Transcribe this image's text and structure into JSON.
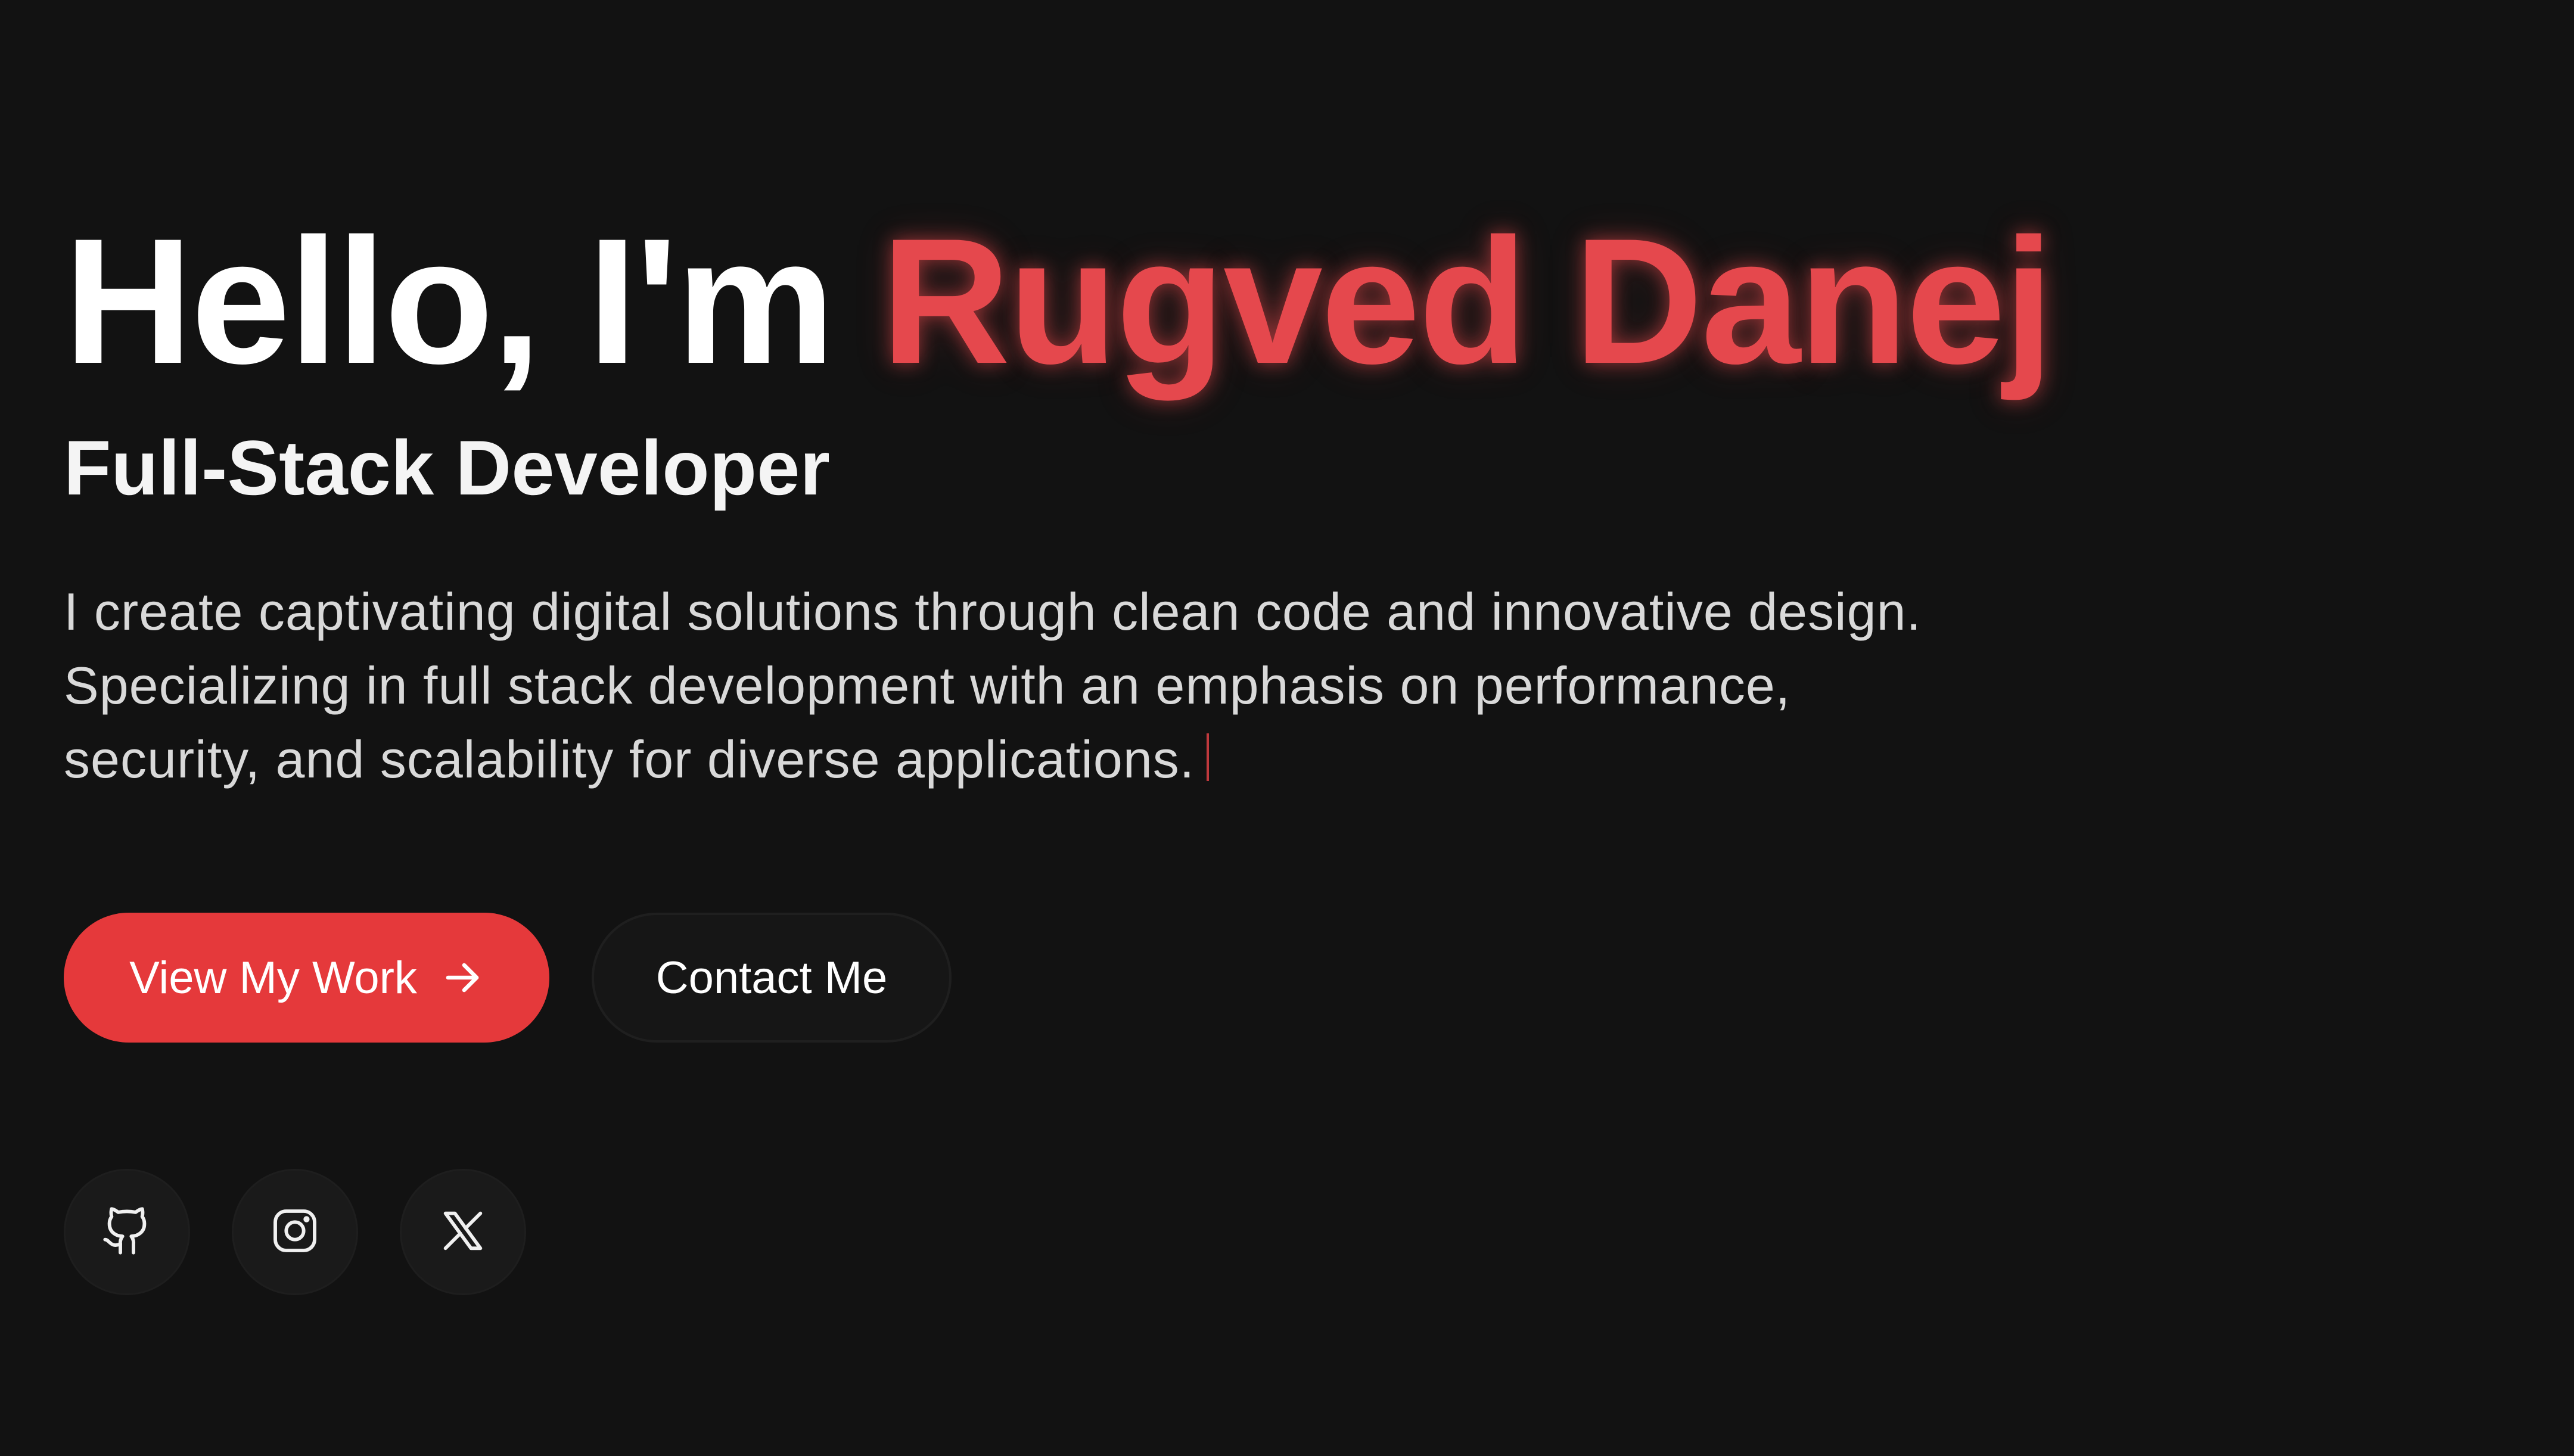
{
  "hero": {
    "greeting": "Hello, I'm",
    "name": "Rugved Danej",
    "role": "Full-Stack Developer",
    "bio_lines": [
      "I create captivating digital solutions through clean code and innovative design.",
      "Specializing in full stack development with an emphasis on performance,",
      "security, and scalability for diverse applications."
    ]
  },
  "buttons": {
    "primary_label": "View My Work",
    "primary_icon": "arrow-right-icon",
    "secondary_label": "Contact Me"
  },
  "social": [
    {
      "icon": "github-icon"
    },
    {
      "icon": "instagram-icon"
    },
    {
      "icon": "x-twitter-icon"
    }
  ],
  "colors": {
    "background": "#121212",
    "accent": "#e5393b",
    "name_highlight": "#e5484d",
    "text": "#ffffff",
    "muted_text": "#d9d9d9"
  }
}
